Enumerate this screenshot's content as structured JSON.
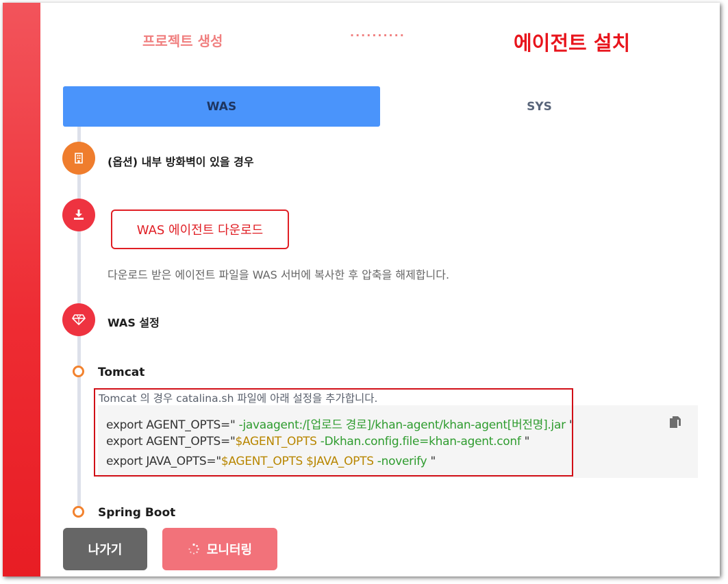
{
  "stepper": {
    "previous": "프로젝트 생성",
    "separator": "··········",
    "current": "에이전트 설치"
  },
  "tabs": [
    {
      "label": "WAS",
      "active": true
    },
    {
      "label": "SYS",
      "active": false
    }
  ],
  "steps": {
    "firewall": {
      "icon": "building-icon",
      "label": "(옵션) 내부 방화벽이 있을 경우"
    },
    "download": {
      "icon": "download-icon",
      "button_label": "WAS 에이전트 다운로드",
      "description": "다운로드 받은 에이전트 파일을 WAS 서버에 복사한 후 압축을 해제합니다."
    },
    "was_config": {
      "icon": "diamond-icon",
      "label": "WAS 설정"
    }
  },
  "tomcat": {
    "title": "Tomcat",
    "note": "Tomcat 의 경우 catalina.sh 파일에 아래 설정을 추가합니다.",
    "code": {
      "line1_prefix": "export AGENT_OPTS=\"",
      "line1_value": " -javaagent:/[업로드 경로]/khan-agent/khan-agent[버전명].jar ",
      "line1_suffix": "\"",
      "line2_prefix": "export AGENT_OPTS=\"",
      "line2_var": "$AGENT_OPTS",
      "line2_value": " -Dkhan.config.file=khan-agent.conf ",
      "line2_suffix": "\"",
      "line3_prefix": "export JAVA_OPTS=\"",
      "line3_var": "$AGENT_OPTS $JAVA_OPTS",
      "line3_value": " -noverify ",
      "line3_suffix": "\""
    }
  },
  "spring_boot": {
    "title": "Spring Boot"
  },
  "footer": {
    "exit_label": "나가기",
    "monitor_label": "모니터링"
  },
  "colors": {
    "accent_red": "#e8141c",
    "tab_active": "#4a94fb",
    "step_orange": "#ef7d2d",
    "step_red": "#ee3340",
    "code_string": "#2f9c2f",
    "code_variable": "#b88600"
  }
}
